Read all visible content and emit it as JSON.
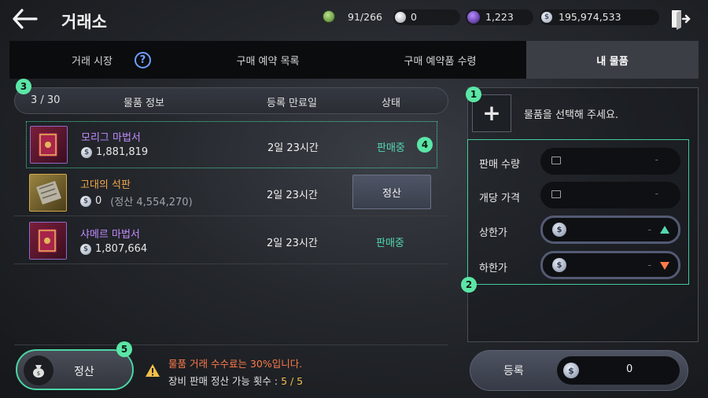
{
  "header": {
    "title": "거래소",
    "currencies": [
      {
        "icon": "inventory-icon",
        "value": "91/266"
      },
      {
        "icon": "pearl-icon",
        "value": "0"
      },
      {
        "icon": "purple-gem-icon",
        "value": "1,223"
      },
      {
        "icon": "silver-coin-icon",
        "value": "195,974,533"
      }
    ]
  },
  "tabs": [
    {
      "label": "거래 시장",
      "active": false
    },
    {
      "label": "구매 예약 목록",
      "active": false
    },
    {
      "label": "구매 예약품 수령",
      "active": false
    },
    {
      "label": "내 물품",
      "active": true
    }
  ],
  "help_icon_label": "?",
  "table": {
    "count": "3 / 30",
    "columns": [
      "물품 정보",
      "등록 만료일",
      "상태"
    ],
    "rows": [
      {
        "name": "모리그 마법서",
        "name_color": "#c28cff",
        "price": "1,881,819",
        "price_note": "",
        "expiry": "2일 23시간",
        "status": "판매중",
        "action": ""
      },
      {
        "name": "고대의 석판",
        "name_color": "#f2a84a",
        "price": "0",
        "price_note": "(정산 4,554,270)",
        "expiry": "2일 23시간",
        "status": "",
        "action": "정산"
      },
      {
        "name": "샤메르 마법서",
        "name_color": "#c28cff",
        "price": "1,807,664",
        "price_note": "",
        "expiry": "2일 23시간",
        "status": "판매중",
        "action": ""
      }
    ]
  },
  "badges": [
    "1",
    "2",
    "3",
    "4",
    "5"
  ],
  "bottom": {
    "settle_label": "정산",
    "fee_notice": "물품 거래 수수료는 30%입니다.",
    "sale_count_label": "장비 판매 정산 가능 횟수 : ",
    "sale_count_value": "5 / 5"
  },
  "register_panel": {
    "add_icon": "+",
    "select_prompt": "물품을 선택해 주세요.",
    "fields": [
      {
        "label": "판매 수량",
        "value": "-"
      },
      {
        "label": "개당 가격",
        "value": "-"
      },
      {
        "label": "상한가",
        "value": "-"
      },
      {
        "label": "하한가",
        "value": "-"
      }
    ],
    "register_label": "등록",
    "total_amount": "0"
  },
  "colors": {
    "accent_green": "#4ad6a4",
    "status_selling": "#52d8b0",
    "warning": "#ff7a4a",
    "magic_item": "#c28cff",
    "rare_item": "#f2a84a"
  }
}
